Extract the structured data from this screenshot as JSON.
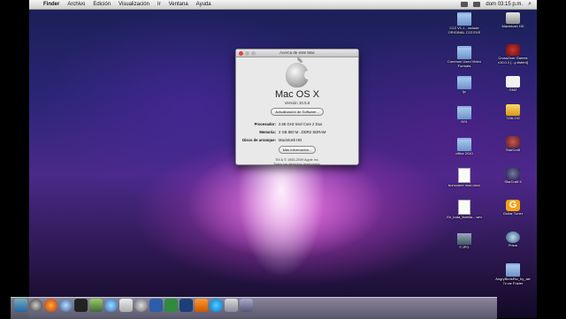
{
  "menubar": {
    "apple": "",
    "menus": [
      "Finder",
      "Archivo",
      "Edición",
      "Visualización",
      "Ir",
      "Ventana",
      "Ayuda"
    ],
    "clock": "dom 03:15 p.m."
  },
  "about_window": {
    "title": "Acerca de este Mac",
    "os_name": "Mac OS X",
    "version": "Versión 10.5.8",
    "update_button": "Actualización de Software...",
    "processor_label": "Procesador:",
    "processor_value": "2.66 GHz Intel Core 2 Duo",
    "memory_label": "Memoria:",
    "memory_value": "2 GB 800 M...DDR2 SDRAM",
    "disk_label": "Disco de arranque:",
    "disk_value": "Macintosh HD",
    "more_info_button": "Más información...",
    "legal_line1": "TM & © 1983-2009 Apple Inc.",
    "legal_line2": "Todos los derechos reservados."
  },
  "desktop_icons_left": [
    {
      "label": "C2Z V1.1 - include ORIGINAL C2Z.EXE",
      "type": "folder"
    },
    {
      "label": "Common Used Video Formats",
      "type": "folder"
    },
    {
      "label": "ljc",
      "type": "folder"
    },
    {
      "label": "N91",
      "type": "folder"
    },
    {
      "label": "office 2010",
      "type": "folder"
    },
    {
      "label": "buncomer mac.docx",
      "type": "doc"
    },
    {
      "label": "En_toda_familia....wm",
      "type": "doc"
    },
    {
      "label": "F.JPG",
      "type": "image"
    }
  ],
  "desktop_icons_right": [
    {
      "label": "Macintosh HD",
      "type": "drive"
    },
    {
      "label": "CrossOver Games v10.0.1 [...y-tisterd]",
      "type": "app"
    },
    {
      "label": "GMZ",
      "type": "drive"
    },
    {
      "label": "7ZALOG",
      "type": "app"
    },
    {
      "label": "StarCraft",
      "type": "app"
    },
    {
      "label": "StarCraft II",
      "type": "app"
    },
    {
      "label": "Guitar Tuner",
      "type": "app"
    },
    {
      "label": "Prism",
      "type": "app"
    },
    {
      "label": "AngryBirdsRio_by_ale 7z.rar Folder",
      "type": "folder"
    }
  ],
  "dock_icons": [
    "finder-icon",
    "dashboard-icon",
    "firefox-icon",
    "safari-icon",
    "terminal-icon",
    "iphoto-icon",
    "itunes-icon",
    "preview-icon",
    "system-prefs-icon",
    "word-icon",
    "excel-icon",
    "photoshop-icon",
    "vlc-icon",
    "skype-icon",
    "mail-icon",
    "downloads-icon"
  ]
}
